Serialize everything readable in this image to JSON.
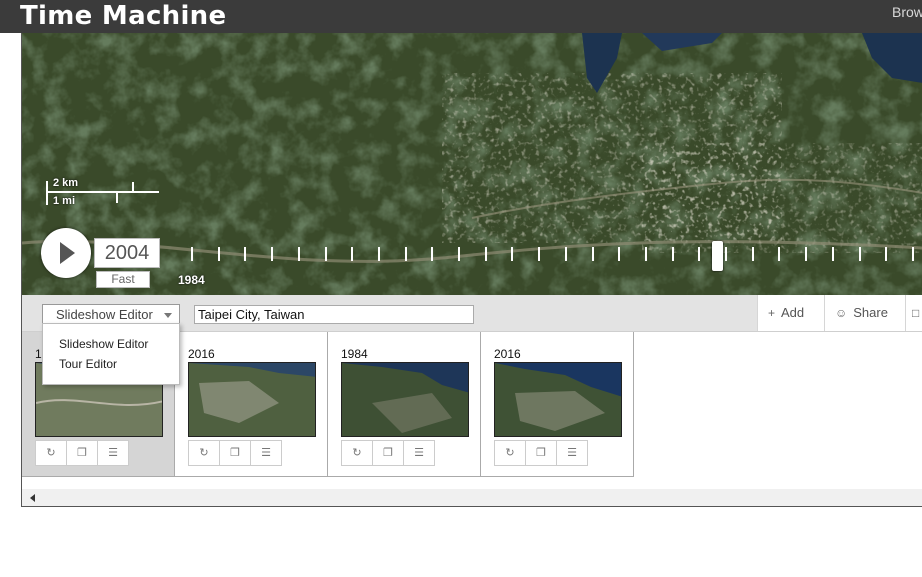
{
  "header": {
    "title": "Time Machine",
    "browse_label": "Brow"
  },
  "map": {
    "scale_km": "2 km",
    "scale_mi": "1 mi"
  },
  "timeline": {
    "current_year": "2004",
    "speed": "Fast",
    "start_year": "1984",
    "progress": 0.73
  },
  "toolbar": {
    "editor_select": "Slideshow Editor",
    "location_value": "Taipei City, Taiwan",
    "add_label": "Add",
    "share_label": "Share"
  },
  "dropdown": {
    "options": [
      "Slideshow Editor",
      "Tour Editor"
    ]
  },
  "cards": [
    {
      "year": "1984",
      "active": true
    },
    {
      "year": "2016",
      "active": false
    },
    {
      "year": "1984",
      "active": false
    },
    {
      "year": "2016",
      "active": false
    }
  ],
  "icons": {
    "card_buttons": [
      "sync-icon",
      "copy-icon",
      "comment-icon"
    ],
    "add": "plus-icon",
    "share": "share-icon",
    "folder": "folder-icon",
    "play": "play-icon"
  },
  "colors": {
    "header_bg": "#3b3b3b",
    "toolbar_bg": "#e3e3e3",
    "active_card_bg": "#d5d5d5",
    "terrain_green": "#2f3c22",
    "water_blue": "#1c3350"
  }
}
